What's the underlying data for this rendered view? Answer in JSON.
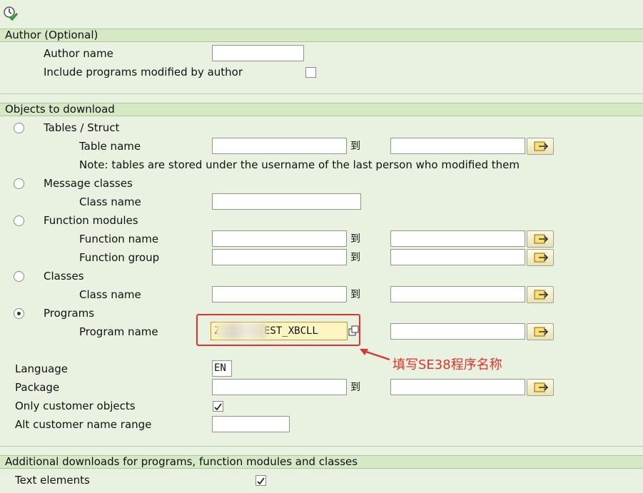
{
  "toolbar": {
    "execute_icon": "execute-clock-check-icon"
  },
  "author_section": {
    "title": "Author (Optional)",
    "author_name_label": "Author name",
    "author_name_value": "",
    "include_modified_label": "Include programs modified by author",
    "include_modified_checked": false
  },
  "objects_section": {
    "title": "Objects to download",
    "range_to_label": "到",
    "tables": {
      "radio_label": "Tables / Struct",
      "table_name_label": "Table name",
      "note": "Note: tables are stored under the username of the last person who modified them"
    },
    "message_classes": {
      "radio_label": "Message classes",
      "class_name_label": "Class name"
    },
    "function_modules": {
      "radio_label": "Function modules",
      "function_name_label": "Function name",
      "function_group_label": "Function group"
    },
    "classes": {
      "radio_label": "Classes",
      "class_name_label": "Class name"
    },
    "programs": {
      "radio_label": "Programs",
      "selected": true,
      "program_name_label": "Program name",
      "program_name_value_visible": "EST_XBCLL",
      "program_name_prefix_visible": "Z"
    },
    "language_label": "Language",
    "language_value": "EN",
    "package_label": "Package",
    "only_customer_label": "Only customer objects",
    "only_customer_checked": true,
    "alt_customer_label": "Alt customer name range"
  },
  "additional_section": {
    "title": "Additional downloads for programs, function modules and classes",
    "text_elements_label": "Text elements",
    "text_elements_checked": true
  },
  "annotation": {
    "text": "填写SE38程序名称",
    "color": "#e0332e"
  },
  "colors": {
    "background": "#e9f2e0",
    "section_header": "#d6e8c6",
    "accent_red": "#e0332e"
  }
}
